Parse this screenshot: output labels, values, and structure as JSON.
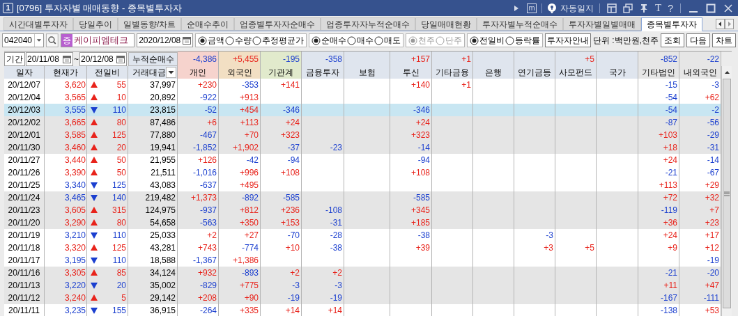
{
  "window": {
    "number": "1",
    "title": "[0796] 투자자별 매매동향 - 종목별투자자",
    "m_button": "m",
    "auto_log": "자동일지",
    "font_button": "T",
    "help_button": "?"
  },
  "tabs": [
    {
      "label": "시간대별투자자",
      "selected": false
    },
    {
      "label": "당일추이",
      "selected": false
    },
    {
      "label": "일별동향/차트",
      "selected": false
    },
    {
      "label": "순매수추이",
      "selected": false
    },
    {
      "label": "업종별투자자순매수",
      "selected": false
    },
    {
      "label": "업종투자자누적순매수",
      "selected": false
    },
    {
      "label": "당일매매현황",
      "selected": false
    },
    {
      "label": "투자자별누적순매수",
      "selected": false
    },
    {
      "label": "투자자별일별매매",
      "selected": false
    },
    {
      "label": "종목별투자자",
      "selected": true
    }
  ],
  "toolbar": {
    "code": "042040",
    "market_badge": "증",
    "name": "케이피엠테크",
    "date": "2020/12/08",
    "radio_groups": [
      {
        "disabled": false,
        "options": [
          {
            "label": "금액",
            "selected": true
          },
          {
            "label": "수량",
            "selected": false
          },
          {
            "label": "추정평균가",
            "selected": false
          }
        ]
      },
      {
        "disabled": false,
        "options": [
          {
            "label": "순매수",
            "selected": true
          },
          {
            "label": "매수",
            "selected": false
          },
          {
            "label": "매도",
            "selected": false
          }
        ]
      },
      {
        "disabled": true,
        "options": [
          {
            "label": "천주",
            "selected": true
          },
          {
            "label": "단주",
            "selected": false
          }
        ]
      },
      {
        "disabled": false,
        "options": [
          {
            "label": "전일비",
            "selected": true
          },
          {
            "label": "등락률",
            "selected": false
          }
        ]
      }
    ],
    "guide_button": "투자자안내",
    "unit": "단위 :백만원,천주",
    "buttons": [
      "조회",
      "다음",
      "차트"
    ]
  },
  "summary": {
    "period_label": "기간",
    "from": "20/11/08",
    "separator": "~",
    "to": "20/12/08",
    "label": "누적순매수",
    "totals": {
      "individual": "-4,386",
      "foreign": "+5,455",
      "institution": "-195",
      "financial_investment": "-358",
      "investment_trust": "+157",
      "other_finance": "+1",
      "private_fund": "+5",
      "other_corp": "-852",
      "domestic_foreign": "-22"
    }
  },
  "table": {
    "columns": [
      {
        "label": "일자",
        "color": "#dfe5ee",
        "menu": false
      },
      {
        "label": "현재가",
        "color": "#dfe5ee",
        "menu": false
      },
      {
        "label": "전일비",
        "color": "#dfe5ee",
        "menu": false
      },
      {
        "label": "거래대금",
        "color": "#dfe5ee",
        "menu": true
      },
      {
        "label": "개인",
        "color": "#f6d3cd",
        "menu": false
      },
      {
        "label": "외국인",
        "color": "#f2dfc3",
        "menu": false
      },
      {
        "label": "기관계",
        "color": "#e1eacc",
        "menu": false
      },
      {
        "label": "금융투자",
        "color": "#dfe5ee",
        "menu": false
      },
      {
        "label": "보험",
        "color": "#dfe5ee",
        "menu": false
      },
      {
        "label": "투신",
        "color": "#dfe5ee",
        "menu": false
      },
      {
        "label": "기타금융",
        "color": "#dfe5ee",
        "menu": false
      },
      {
        "label": "은행",
        "color": "#dfe5ee",
        "menu": false
      },
      {
        "label": "연기금등",
        "color": "#dfe5ee",
        "menu": false
      },
      {
        "label": "사모펀드",
        "color": "#dfe5ee",
        "menu": false
      },
      {
        "label": "국가",
        "color": "#dfe5ee",
        "menu": false
      },
      {
        "label": "기타법인",
        "color": "#e6e6e6",
        "menu": false
      },
      {
        "label": "내외국인",
        "color": "#e6e6e6",
        "menu": false
      }
    ],
    "rows": [
      {
        "date": "20/12/07",
        "price": "3,620",
        "rising": true,
        "change": "55",
        "amount": "37,997",
        "selected": false,
        "values": {
          "individual": "+230",
          "foreign": "-353",
          "institution": "+141",
          "investment_trust": "+140",
          "other_finance": "+1",
          "other_corp": "-15",
          "domestic_foreign": "-3"
        }
      },
      {
        "date": "20/12/04",
        "price": "3,565",
        "rising": true,
        "change": "10",
        "amount": "20,892",
        "selected": false,
        "values": {
          "individual": "-922",
          "foreign": "+913",
          "other_corp": "-54",
          "domestic_foreign": "+62"
        }
      },
      {
        "date": "20/12/03",
        "price": "3,555",
        "rising": false,
        "change": "110",
        "amount": "23,815",
        "selected": true,
        "values": {
          "individual": "-52",
          "foreign": "+454",
          "institution": "-346",
          "investment_trust": "-346",
          "other_corp": "-54",
          "domestic_foreign": "-2"
        }
      },
      {
        "date": "20/12/02",
        "price": "3,665",
        "rising": true,
        "change": "80",
        "amount": "87,486",
        "selected": false,
        "values": {
          "individual": "+6",
          "foreign": "+113",
          "institution": "+24",
          "investment_trust": "+24",
          "other_corp": "-87",
          "domestic_foreign": "-56"
        }
      },
      {
        "date": "20/12/01",
        "price": "3,585",
        "rising": true,
        "change": "125",
        "amount": "77,880",
        "selected": false,
        "values": {
          "individual": "-467",
          "foreign": "+70",
          "institution": "+323",
          "investment_trust": "+323",
          "other_corp": "+103",
          "domestic_foreign": "-29"
        }
      },
      {
        "date": "20/11/30",
        "price": "3,460",
        "rising": true,
        "change": "20",
        "amount": "19,941",
        "selected": false,
        "values": {
          "individual": "-1,852",
          "foreign": "+1,902",
          "institution": "-37",
          "financial_investment": "-23",
          "investment_trust": "-14",
          "other_corp": "+18",
          "domestic_foreign": "-31"
        }
      },
      {
        "date": "20/11/27",
        "price": "3,440",
        "rising": true,
        "change": "50",
        "amount": "21,955",
        "selected": false,
        "values": {
          "individual": "+126",
          "foreign": "-42",
          "institution": "-94",
          "investment_trust": "-94",
          "other_corp": "+24",
          "domestic_foreign": "-14"
        }
      },
      {
        "date": "20/11/26",
        "price": "3,390",
        "rising": true,
        "change": "50",
        "amount": "21,511",
        "selected": false,
        "values": {
          "individual": "-1,016",
          "foreign": "+996",
          "institution": "+108",
          "investment_trust": "+108",
          "other_corp": "-21",
          "domestic_foreign": "-67"
        }
      },
      {
        "date": "20/11/25",
        "price": "3,340",
        "rising": false,
        "change": "125",
        "amount": "43,083",
        "selected": false,
        "values": {
          "individual": "-637",
          "foreign": "+495",
          "other_corp": "+113",
          "domestic_foreign": "+29"
        }
      },
      {
        "date": "20/11/24",
        "price": "3,465",
        "rising": false,
        "change": "140",
        "amount": "219,482",
        "selected": false,
        "values": {
          "individual": "+1,373",
          "foreign": "-892",
          "institution": "-585",
          "investment_trust": "-585",
          "other_corp": "+72",
          "domestic_foreign": "+32"
        }
      },
      {
        "date": "20/11/23",
        "price": "3,605",
        "rising": true,
        "change": "315",
        "amount": "124,975",
        "selected": false,
        "values": {
          "individual": "-937",
          "foreign": "+812",
          "institution": "+236",
          "financial_investment": "-108",
          "investment_trust": "+345",
          "other_corp": "-119",
          "domestic_foreign": "+7"
        }
      },
      {
        "date": "20/11/20",
        "price": "3,290",
        "rising": true,
        "change": "80",
        "amount": "54,658",
        "selected": false,
        "values": {
          "individual": "-563",
          "foreign": "+350",
          "institution": "+153",
          "financial_investment": "-31",
          "investment_trust": "+185",
          "other_corp": "+36",
          "domestic_foreign": "+23"
        }
      },
      {
        "date": "20/11/19",
        "price": "3,210",
        "rising": false,
        "change": "110",
        "amount": "25,033",
        "selected": false,
        "values": {
          "individual": "+2",
          "foreign": "+27",
          "institution": "-70",
          "financial_investment": "-28",
          "investment_trust": "-38",
          "pension": "-3",
          "other_corp": "+24",
          "domestic_foreign": "+17"
        }
      },
      {
        "date": "20/11/18",
        "price": "3,320",
        "rising": true,
        "change": "125",
        "amount": "43,281",
        "selected": false,
        "values": {
          "individual": "+743",
          "foreign": "-774",
          "institution": "+10",
          "financial_investment": "-38",
          "investment_trust": "+39",
          "pension": "+3",
          "private_fund": "+5",
          "other_corp": "+9",
          "domestic_foreign": "+12"
        }
      },
      {
        "date": "20/11/17",
        "price": "3,195",
        "rising": false,
        "change": "110",
        "amount": "18,588",
        "selected": false,
        "values": {
          "individual": "-1,367",
          "foreign": "+1,386",
          "domestic_foreign": "-19"
        }
      },
      {
        "date": "20/11/16",
        "price": "3,305",
        "rising": true,
        "change": "85",
        "amount": "34,124",
        "selected": false,
        "values": {
          "individual": "+932",
          "foreign": "-893",
          "institution": "+2",
          "financial_investment": "+2",
          "other_corp": "-21",
          "domestic_foreign": "-20"
        }
      },
      {
        "date": "20/11/13",
        "price": "3,220",
        "rising": false,
        "change": "20",
        "amount": "35,002",
        "selected": false,
        "values": {
          "individual": "-829",
          "foreign": "+775",
          "institution": "-3",
          "financial_investment": "-3",
          "other_corp": "+11",
          "domestic_foreign": "+47"
        }
      },
      {
        "date": "20/11/12",
        "price": "3,240",
        "rising": true,
        "change": "5",
        "amount": "29,142",
        "selected": false,
        "values": {
          "individual": "+208",
          "foreign": "+90",
          "institution": "-19",
          "financial_investment": "-19",
          "other_corp": "-167",
          "domestic_foreign": "-111"
        }
      },
      {
        "date": "20/11/11",
        "price": "3,235",
        "rising": false,
        "change": "155",
        "amount": "36,915",
        "selected": false,
        "values": {
          "individual": "-264",
          "foreign": "+335",
          "institution": "+14",
          "financial_investment": "+14",
          "other_corp": "-138",
          "domestic_foreign": "+53"
        }
      }
    ]
  }
}
